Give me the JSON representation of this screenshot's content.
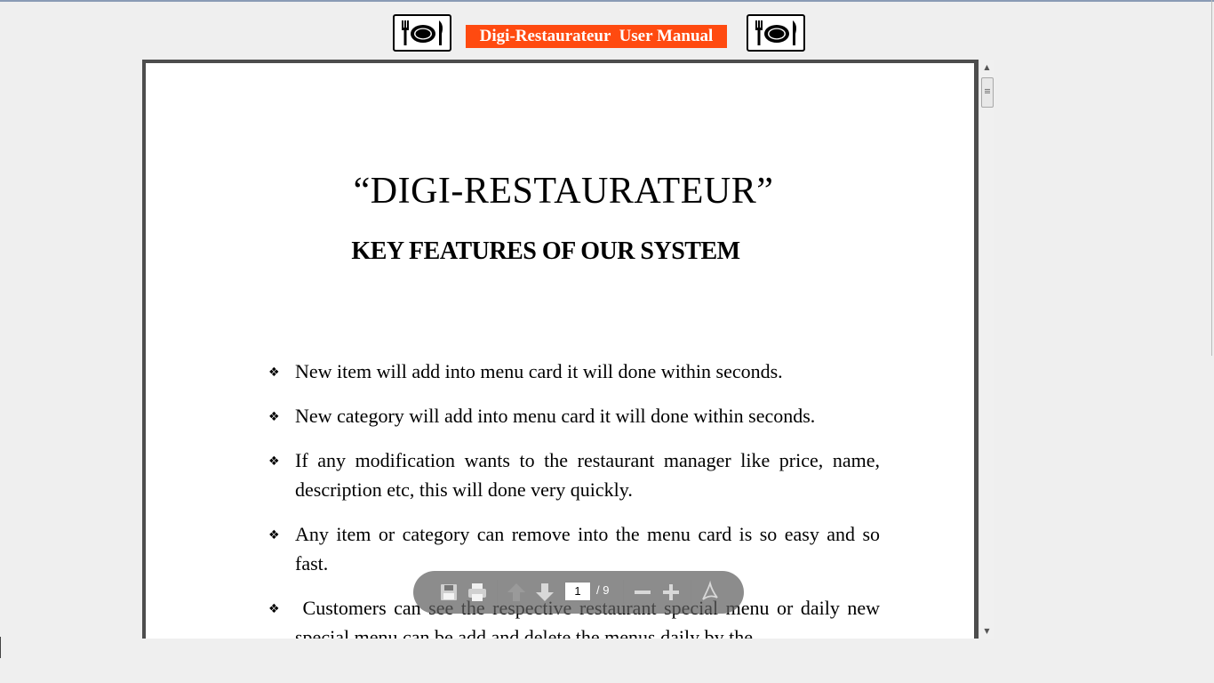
{
  "header": {
    "title": "Digi-Restaurateur  User Manual",
    "logo_icon": "plate-cutlery-icon",
    "badge_color": "#ff4a10"
  },
  "document": {
    "title": "“DIGI-RESTAURATEUR”",
    "subtitle": "KEY FEATURES OF OUR SYSTEM",
    "bullets": [
      "New item will add into menu card it will done within seconds.",
      "New category will add into menu card it will done within seconds.",
      "If any modification wants to the restaurant manager like price, name, description etc, this will done very quickly.",
      "Any item or category can remove into the menu card is so easy and so fast.",
      " Customers can see the respective restaurant special menu or daily new special menu can be add and delete the menus daily by the"
    ],
    "bullet_icon": "diamond-bullet-icon"
  },
  "pdf_toolbar": {
    "current_page": "1",
    "page_total": "/ 9",
    "buttons": [
      "save-icon",
      "print-icon",
      "previous-page-icon",
      "next-page-icon",
      "zoom-out-icon",
      "zoom-in-icon",
      "acrobat-icon"
    ]
  }
}
